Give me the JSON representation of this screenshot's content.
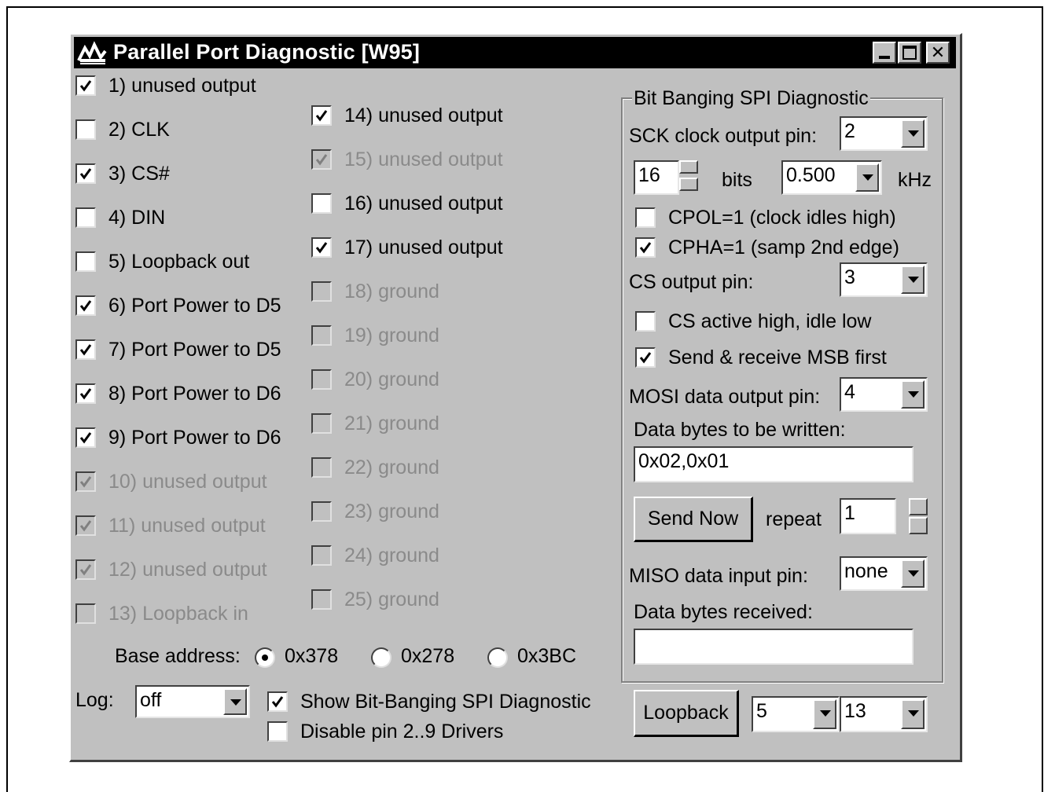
{
  "window": {
    "title": "Parallel Port Diagnostic [W95]",
    "controls": [
      "minimize",
      "maximize",
      "close"
    ]
  },
  "pins_left": [
    {
      "label": "1) unused output",
      "checked": true,
      "enabled": true
    },
    {
      "label": "2) CLK",
      "checked": false,
      "enabled": true
    },
    {
      "label": "3) CS#",
      "checked": true,
      "enabled": true
    },
    {
      "label": "4) DIN",
      "checked": false,
      "enabled": true
    },
    {
      "label": "5) Loopback out",
      "checked": false,
      "enabled": true
    },
    {
      "label": "6) Port Power to D5",
      "checked": true,
      "enabled": true
    },
    {
      "label": "7) Port Power to D5",
      "checked": true,
      "enabled": true
    },
    {
      "label": "8) Port Power to D6",
      "checked": true,
      "enabled": true
    },
    {
      "label": "9) Port Power to D6",
      "checked": true,
      "enabled": true
    },
    {
      "label": "10) unused output",
      "checked": true,
      "enabled": false
    },
    {
      "label": "11) unused output",
      "checked": true,
      "enabled": false
    },
    {
      "label": "12) unused output",
      "checked": true,
      "enabled": false
    },
    {
      "label": "13) Loopback in",
      "checked": false,
      "enabled": false
    }
  ],
  "pins_right": [
    {
      "label": "14) unused output",
      "checked": true,
      "enabled": true
    },
    {
      "label": "15) unused output",
      "checked": true,
      "enabled": false
    },
    {
      "label": "16) unused output",
      "checked": false,
      "enabled": true
    },
    {
      "label": "17) unused output",
      "checked": true,
      "enabled": true
    },
    {
      "label": "18) ground",
      "checked": false,
      "enabled": false
    },
    {
      "label": "19) ground",
      "checked": false,
      "enabled": false
    },
    {
      "label": "20) ground",
      "checked": false,
      "enabled": false
    },
    {
      "label": "21) ground",
      "checked": false,
      "enabled": false
    },
    {
      "label": "22) ground",
      "checked": false,
      "enabled": false
    },
    {
      "label": "23) ground",
      "checked": false,
      "enabled": false
    },
    {
      "label": "24) ground",
      "checked": false,
      "enabled": false
    },
    {
      "label": "25) ground",
      "checked": false,
      "enabled": false
    }
  ],
  "base_address": {
    "label": "Base address:",
    "options": [
      "0x378",
      "0x278",
      "0x3BC"
    ],
    "selected": "0x378"
  },
  "log": {
    "label": "Log:",
    "value": "off"
  },
  "show_spi": {
    "label": "Show Bit-Banging SPI Diagnostic",
    "checked": true
  },
  "disable_drivers": {
    "label": "Disable pin 2..9 Drivers",
    "checked": false
  },
  "spi": {
    "group_title": "Bit Banging SPI Diagnostic",
    "sck_label": "SCK clock output pin:",
    "sck_value": "2",
    "bits_value": "16",
    "bits_label": "bits",
    "freq_value": "0.500",
    "freq_unit": "kHz",
    "cpol": {
      "label": "CPOL=1 (clock idles high)",
      "checked": false
    },
    "cpha": {
      "label": "CPHA=1 (samp 2nd edge)",
      "checked": true
    },
    "cs_label": "CS output pin:",
    "cs_value": "3",
    "cs_active": {
      "label": "CS active high, idle low",
      "checked": false
    },
    "msb_first": {
      "label": "Send & receive MSB first",
      "checked": true
    },
    "mosi_label": "MOSI data output pin:",
    "mosi_value": "4",
    "write_label": "Data bytes to be written:",
    "write_value": "0x02,0x01",
    "send_button": "Send Now",
    "repeat_label": "repeat",
    "repeat_value": "1",
    "miso_label": "MISO data input pin:",
    "miso_value": "none",
    "received_label": "Data bytes received:",
    "received_value": ""
  },
  "loopback": {
    "button": "Loopback",
    "out_value": "5",
    "in_value": "13"
  }
}
